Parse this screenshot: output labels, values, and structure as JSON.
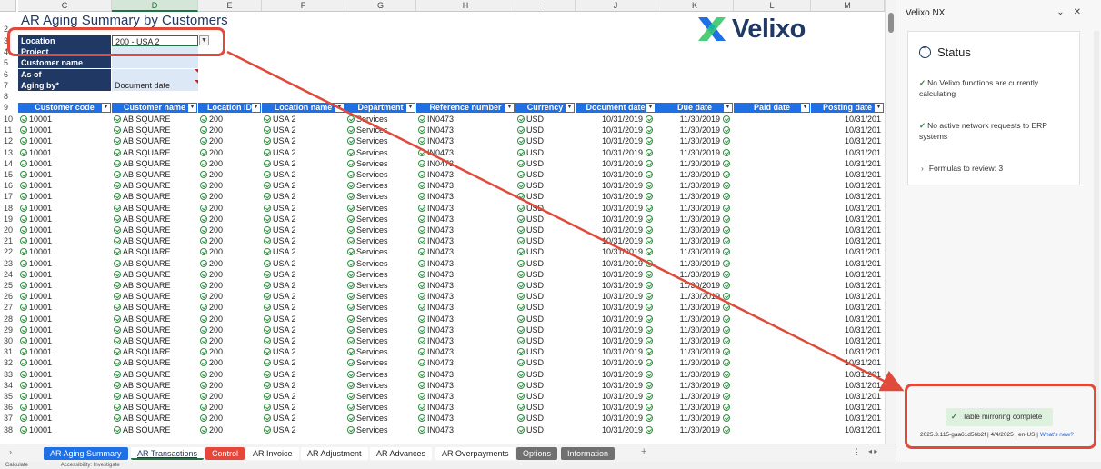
{
  "columns": [
    "C",
    "D",
    "E",
    "F",
    "G",
    "H",
    "I",
    "J",
    "K",
    "L",
    "M"
  ],
  "selected_column": "D",
  "title": "AR Aging Summary by Customers",
  "logo_text": "Velixo",
  "params": [
    {
      "row": "3",
      "label": "Location",
      "value": "200 - USA 2"
    },
    {
      "row": "4",
      "label": "Project",
      "value": ""
    },
    {
      "row": "5",
      "label": "Customer name",
      "value": ""
    },
    {
      "row": "6",
      "label": "As of",
      "value": ""
    },
    {
      "row": "7",
      "label": "Aging by*",
      "value": "Document date"
    }
  ],
  "table": {
    "headers": [
      "Customer code",
      "Customer name",
      "Location ID",
      "Location name",
      "Department",
      "Reference number",
      "Currency",
      "Document date",
      "Due date",
      "Paid date",
      "Posting date"
    ],
    "row_template": [
      "10001",
      "AB SQUARE",
      "200",
      "USA 2",
      "Services",
      "IN0473",
      "USD",
      "10/31/2019",
      "11/30/2019",
      "",
      "10/31/201"
    ],
    "first_row_number": 10,
    "row_count": 29
  },
  "tabs": [
    {
      "label": "AR Aging Summary",
      "style": "blue"
    },
    {
      "label": "AR Transactions",
      "style": "active"
    },
    {
      "label": "Control",
      "style": "red"
    },
    {
      "label": "AR Invoice",
      "style": "plain"
    },
    {
      "label": "AR Adjustment",
      "style": "plain"
    },
    {
      "label": "AR Advances",
      "style": "plain"
    },
    {
      "label": "AR Overpayments",
      "style": "plain"
    },
    {
      "label": "Options",
      "style": "gray"
    },
    {
      "label": "Information",
      "style": "gray"
    }
  ],
  "tab_add": "+",
  "statusbar": {
    "left": "Calculate",
    "accessibility": "Accessibility: Investigate"
  },
  "panel": {
    "title": "Velixo NX",
    "status_heading": "Status",
    "items": [
      "No Velixo functions are currently calculating",
      "No active network requests to ERP systems"
    ],
    "formulas": "Formulas to review: 3",
    "toast": "Table mirroring complete",
    "version": "2025.3.115-gaa61d56b2f | 4/4/2025 | en-US |",
    "whats_new": "What's new?"
  },
  "colors": {
    "header_blue": "#1f6fe5",
    "navy": "#1f3864",
    "annotation_red": "#e04a3a",
    "toast_green": "#def0de"
  }
}
